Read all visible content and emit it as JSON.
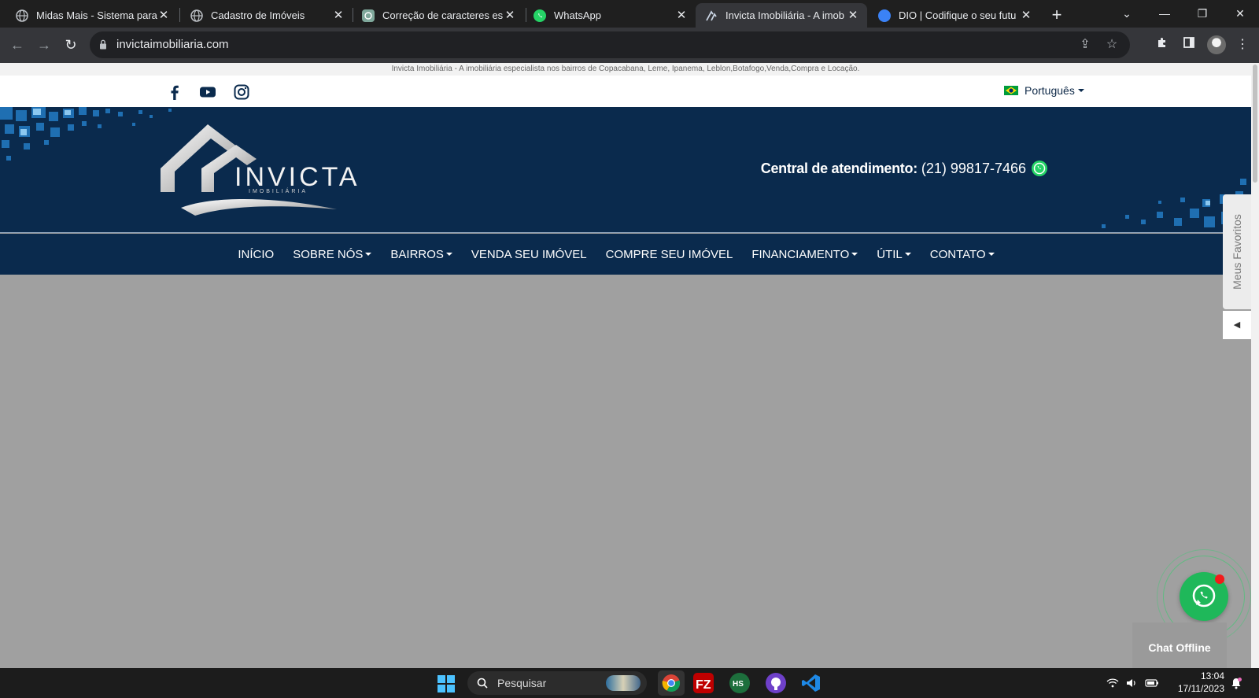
{
  "browser": {
    "tabs": [
      {
        "title": "Midas Mais - Sistema para",
        "active": false
      },
      {
        "title": "Cadastro de Imóveis",
        "active": false
      },
      {
        "title": "Correção de caracteres esp",
        "active": false
      },
      {
        "title": "WhatsApp",
        "active": false
      },
      {
        "title": "Invicta Imobiliária - A imob",
        "active": true
      },
      {
        "title": "DIO | Codifique o seu futu",
        "active": false
      }
    ],
    "url": "invictaimobiliaria.com"
  },
  "site": {
    "tagline": "Invicta Imobiliária - A imobiliária especialista nos bairros de Copacabana, Leme, Ipanema, Leblon,Botafogo,Venda,Compra e Locação.",
    "language": "Português",
    "logo_text": "INVICTA",
    "logo_subtext": "IMOBILIÁRIA",
    "contact_label": "Central de atendimento:",
    "contact_phone": "(21) 99817-7466",
    "nav": [
      {
        "label": "INÍCIO",
        "dropdown": false
      },
      {
        "label": "SOBRE NÓS",
        "dropdown": true
      },
      {
        "label": "BAIRROS",
        "dropdown": true
      },
      {
        "label": "VENDA SEU IMÓVEL",
        "dropdown": false
      },
      {
        "label": "COMPRE SEU IMÓVEL",
        "dropdown": false
      },
      {
        "label": "FINANCIAMENTO",
        "dropdown": true
      },
      {
        "label": "ÚTIL",
        "dropdown": true
      },
      {
        "label": "CONTATO",
        "dropdown": true
      }
    ],
    "favorites_label": "Meus Favoritos",
    "chat_status": "Chat Offline"
  },
  "taskbar": {
    "search_placeholder": "Pesquisar",
    "time": "13:04",
    "date": "17/11/2023"
  },
  "colors": {
    "header_navy": "#0a2a4d",
    "whatsapp_green": "#1fb85a",
    "page_gray": "#a0a0a0"
  }
}
